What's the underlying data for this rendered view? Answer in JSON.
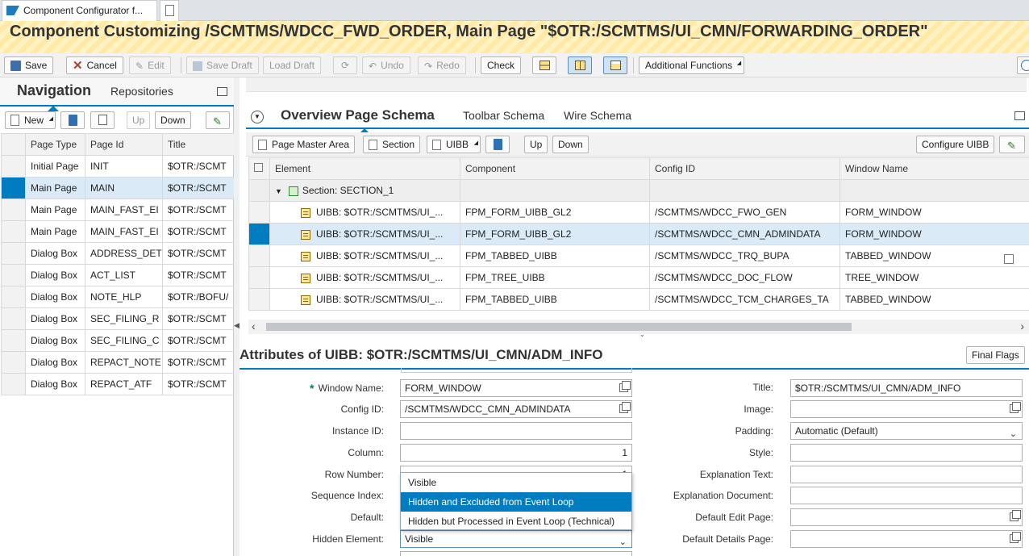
{
  "browser": {
    "tab_title": "Component Configurator f..."
  },
  "page": {
    "title": "Component Customizing /SCMTMS/WDCC_FWD_ORDER, Main Page \"$OTR:/SCMTMS/UI_CMN/FORWARDING_ORDER\""
  },
  "toolbar": {
    "save": "Save",
    "cancel": "Cancel",
    "edit": "Edit",
    "save_draft": "Save Draft",
    "load_draft": "Load Draft",
    "undo": "Undo",
    "redo": "Redo",
    "check": "Check",
    "additional_functions": "Additional Functions"
  },
  "navigation": {
    "tab_navigation": "Navigation",
    "tab_repositories": "Repositories",
    "new_button": "New",
    "up_button": "Up",
    "down_button": "Down",
    "columns": [
      "Page Type",
      "Page Id",
      "Title"
    ],
    "rows": [
      {
        "type": "Initial Page",
        "id": "INIT",
        "title": "$OTR:/SCMT"
      },
      {
        "type": "Main Page",
        "id": "MAIN",
        "title": "$OTR:/SCMT"
      },
      {
        "type": "Main Page",
        "id": "MAIN_FAST_EI",
        "title": "$OTR:/SCMT"
      },
      {
        "type": "Main Page",
        "id": "MAIN_FAST_EI",
        "title": "$OTR:/SCMT"
      },
      {
        "type": "Dialog Box",
        "id": "ADDRESS_DET",
        "title": "$OTR:/SCMT"
      },
      {
        "type": "Dialog Box",
        "id": "ACT_LIST",
        "title": "$OTR:/SCMT"
      },
      {
        "type": "Dialog Box",
        "id": "NOTE_HLP",
        "title": "$OTR:/BOFU/"
      },
      {
        "type": "Dialog Box",
        "id": "SEC_FILING_R",
        "title": "$OTR:/SCMT"
      },
      {
        "type": "Dialog Box",
        "id": "SEC_FILING_C",
        "title": "$OTR:/SCMT"
      },
      {
        "type": "Dialog Box",
        "id": "REPACT_NOTE",
        "title": "$OTR:/SCMT"
      },
      {
        "type": "Dialog Box",
        "id": "REPACT_ATF",
        "title": "$OTR:/SCMT"
      }
    ],
    "selected_row": 1
  },
  "schema": {
    "tab_overview": "Overview Page Schema",
    "tab_toolbar": "Toolbar Schema",
    "tab_wire": "Wire Schema",
    "page_master_area_button": "Page Master Area",
    "section_button": "Section",
    "uibb_button": "UIBB",
    "up_button": "Up",
    "down_button": "Down",
    "configure_uibb_button": "Configure UIBB",
    "columns": [
      "Element",
      "Component",
      "Config ID",
      "Window Name"
    ],
    "section_label": "Section: SECTION_1",
    "rows": [
      {
        "element": "UIBB: $OTR:/SCMTMS/UI_...",
        "component": "FPM_FORM_UIBB_GL2",
        "config": "/SCMTMS/WDCC_FWO_GEN",
        "window": "FORM_WINDOW"
      },
      {
        "element": "UIBB: $OTR:/SCMTMS/UI_...",
        "component": "FPM_FORM_UIBB_GL2",
        "config": "/SCMTMS/WDCC_CMN_ADMINDATA",
        "window": "FORM_WINDOW"
      },
      {
        "element": "UIBB: $OTR:/SCMTMS/UI_...",
        "component": "FPM_TABBED_UIBB",
        "config": "/SCMTMS/WDCC_TRQ_BUPA",
        "window": "TABBED_WINDOW"
      },
      {
        "element": "UIBB: $OTR:/SCMTMS/UI_...",
        "component": "FPM_TREE_UIBB",
        "config": "/SCMTMS/WDCC_DOC_FLOW",
        "window": "TREE_WINDOW"
      },
      {
        "element": "UIBB: $OTR:/SCMTMS/UI_...",
        "component": "FPM_TABBED_UIBB",
        "config": "/SCMTMS/WDCC_TCM_CHARGES_TA",
        "window": "TABBED_WINDOW"
      }
    ],
    "selected_row": 1
  },
  "attributes": {
    "title": "Attributes of UIBB: $OTR:/SCMTMS/UI_CMN/ADM_INFO",
    "final_flags_button": "Final Flags",
    "required_mark": "*",
    "left": {
      "window_name_label": "Window Name:",
      "window_name_value": "FORM_WINDOW",
      "config_id_label": "Config ID:",
      "config_id_value": "/SCMTMS/WDCC_CMN_ADMINDATA",
      "instance_id_label": "Instance ID:",
      "instance_id_value": "",
      "column_label": "Column:",
      "column_value": "1",
      "row_number_label": "Row Number:",
      "row_number_value": "1",
      "sequence_index_label": "Sequence Index:",
      "default_label": "Default:",
      "hidden_element_label": "Hidden Element:",
      "hidden_element_value": "Visible"
    },
    "right": {
      "title_label": "Title:",
      "title_value": "$OTR:/SCMTMS/UI_CMN/ADM_INFO",
      "image_label": "Image:",
      "padding_label": "Padding:",
      "padding_value": "Automatic (Default)",
      "style_label": "Style:",
      "explanation_text_label": "Explanation Text:",
      "explanation_document_label": "Explanation Document:",
      "default_edit_page_label": "Default Edit Page:",
      "default_details_page_label": "Default Details Page:"
    },
    "hidden_options": [
      "Visible",
      "Hidden and Excluded from Event Loop",
      "Hidden but Processed in Event Loop (Technical)"
    ],
    "highlighted_option": 1
  },
  "colors": {
    "accent": "#007cc0",
    "selected_row": "#dbeaf7",
    "title_band": "#ffe9a3"
  }
}
